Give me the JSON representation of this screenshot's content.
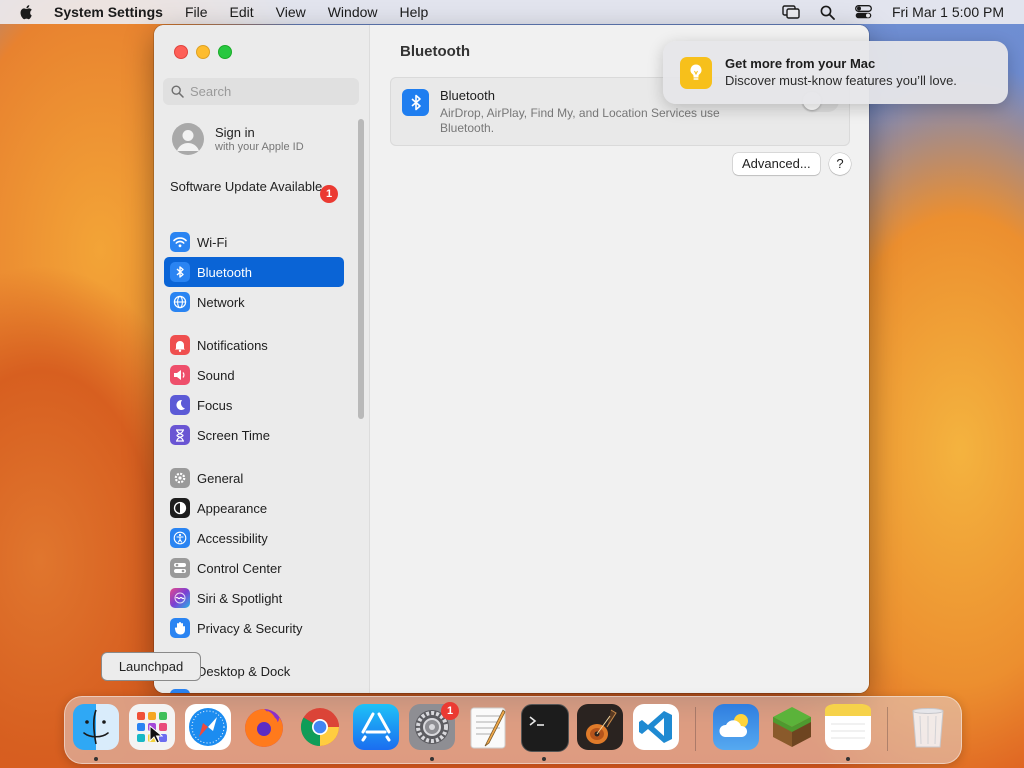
{
  "menubar": {
    "app_name": "System Settings",
    "menus": [
      "File",
      "Edit",
      "View",
      "Window",
      "Help"
    ],
    "datetime": "Fri Mar 1  5:00 PM"
  },
  "sidebar": {
    "search_placeholder": "Search",
    "signin_title": "Sign in",
    "signin_subtitle": "with your Apple ID",
    "update_label": "Software Update Available",
    "update_badge": "1",
    "items": [
      {
        "label": "Wi-Fi",
        "icon": "wifi-icon",
        "color": "#2a84f2"
      },
      {
        "label": "Bluetooth",
        "icon": "bluetooth-icon",
        "color": "#2a84f2",
        "active": true
      },
      {
        "label": "Network",
        "icon": "globe-icon",
        "color": "#2a84f2"
      },
      {
        "label": "Notifications",
        "icon": "bell-icon",
        "color": "#ef4f4f"
      },
      {
        "label": "Sound",
        "icon": "speaker-icon",
        "color": "#ee4f6b"
      },
      {
        "label": "Focus",
        "icon": "moon-icon",
        "color": "#5b5ad6"
      },
      {
        "label": "Screen Time",
        "icon": "hourglass-icon",
        "color": "#6a55d3"
      },
      {
        "label": "General",
        "icon": "gear-icon",
        "color": "#9a9a9a"
      },
      {
        "label": "Appearance",
        "icon": "appearance-icon",
        "color": "#1d1d1d"
      },
      {
        "label": "Accessibility",
        "icon": "accessibility-icon",
        "color": "#2a84f2"
      },
      {
        "label": "Control Center",
        "icon": "control-center-icon",
        "color": "#9a9a9a"
      },
      {
        "label": "Siri & Spotlight",
        "icon": "siri-icon",
        "color": "#7b3fd3"
      },
      {
        "label": "Privacy & Security",
        "icon": "hand-icon",
        "color": "#2a84f2"
      },
      {
        "label": "Desktop & Dock",
        "icon": "dock-icon",
        "color": "#1d1d1d"
      }
    ]
  },
  "content": {
    "title": "Bluetooth",
    "card_title": "Bluetooth",
    "card_desc": "AirDrop, AirPlay, Find My, and Location Services use Bluetooth.",
    "advanced_label": "Advanced...",
    "help_label": "?"
  },
  "notification": {
    "title": "Get more from your Mac",
    "body": "Discover must-know features you’ll love."
  },
  "tooltip": "Launchpad",
  "dock": {
    "settings_badge": "1",
    "apps": [
      "Finder",
      "Launchpad",
      "Safari",
      "Firefox",
      "Chrome",
      "App Store",
      "System Settings",
      "TextEdit",
      "Terminal",
      "GarageBand",
      "VS Code",
      "Weather",
      "Minecraft",
      "Notes",
      "Trash"
    ]
  }
}
